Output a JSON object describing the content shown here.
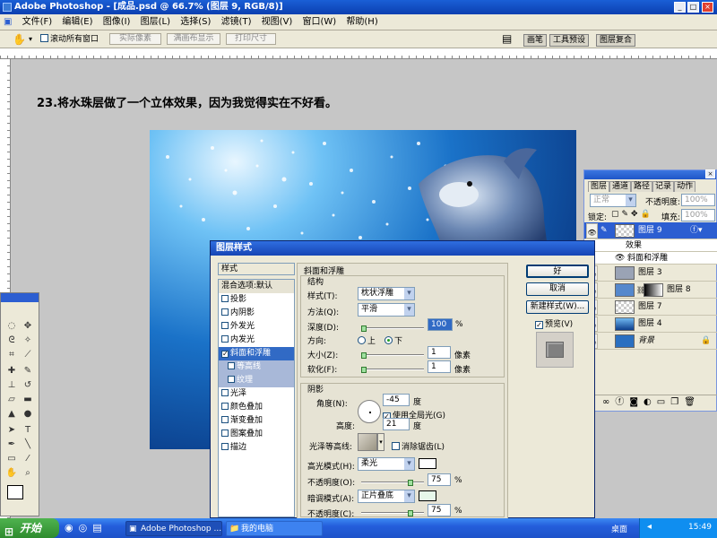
{
  "window": {
    "title": "Adobe Photoshop - [成品.psd @ 66.7% (图层 9, RGB/8)]"
  },
  "menu": [
    "文件(F)",
    "编辑(E)",
    "图像(I)",
    "图层(L)",
    "选择(S)",
    "滤镜(T)",
    "视图(V)",
    "窗口(W)",
    "帮助(H)"
  ],
  "options": {
    "scroll_all_label": "滚动所有窗口",
    "actual_pixels": "实际像素",
    "fit_screen": "满画布显示",
    "print_size": "打印尺寸"
  },
  "dock_tabs": [
    "画笔",
    "工具预设",
    "图层复合"
  ],
  "heading": "23.将水珠层做了一个立体效果，因为我觉得实在不好看。",
  "layers_panel": {
    "tabs": [
      "图层",
      "通道",
      "路径",
      "记录",
      "动作"
    ],
    "blend_mode": "正常",
    "opacity_label": "不透明度:",
    "opacity_value": "100%",
    "lock_label": "锁定:",
    "fill_label": "填充:",
    "fill_value": "100%",
    "layers": [
      {
        "name": "图层 9",
        "selected": true
      },
      {
        "name": "效果",
        "effect_header": true
      },
      {
        "name": "斜面和浮雕",
        "effect": true
      },
      {
        "name": "图层 3"
      },
      {
        "name": "图层 8"
      },
      {
        "name": "图层 7"
      },
      {
        "name": "图层 4"
      },
      {
        "name": "背景",
        "italic": true
      }
    ]
  },
  "dialog": {
    "title": "图层样式",
    "styles_header": "样式",
    "blend_options": "混合选项:默认",
    "styles": [
      {
        "label": "投影",
        "checked": false
      },
      {
        "label": "内阴影",
        "checked": false
      },
      {
        "label": "外发光",
        "checked": false
      },
      {
        "label": "内发光",
        "checked": false
      },
      {
        "label": "斜面和浮雕",
        "checked": true,
        "selected": true
      },
      {
        "label": "等高线",
        "sub": true
      },
      {
        "label": "纹理",
        "sub": true
      },
      {
        "label": "光泽",
        "checked": false
      },
      {
        "label": "颜色叠加",
        "checked": false
      },
      {
        "label": "渐变叠加",
        "checked": false
      },
      {
        "label": "图案叠加",
        "checked": false
      },
      {
        "label": "描边",
        "checked": false
      }
    ],
    "section_title": "斜面和浮雕",
    "structure_title": "结构",
    "style_label": "样式(T):",
    "style_value": "枕状浮雕",
    "technique_label": "方法(Q):",
    "technique_value": "平滑",
    "depth_label": "深度(D):",
    "depth_value": "100",
    "percent": "%",
    "direction_label": "方向:",
    "dir_up": "上",
    "dir_down": "下",
    "size_label": "大小(Z):",
    "size_value": "1",
    "soften_label": "软化(F):",
    "soften_value": "1",
    "px": "像素",
    "shading_title": "阴影",
    "angle_label": "角度(N):",
    "angle_value": "-45",
    "degree": "度",
    "global_light_label": "使用全局光(G)",
    "altitude_label": "高度:",
    "altitude_value": "21",
    "gloss_label": "光泽等高线:",
    "anti_alias_label": "消除锯齿(L)",
    "highlight_mode_label": "高光模式(H):",
    "highlight_mode_value": "柔光",
    "opacity_o_label": "不透明度(O):",
    "opacity_o_value": "75",
    "shadow_mode_label": "暗调模式(A):",
    "shadow_mode_value": "正片叠底",
    "opacity_c_label": "不透明度(C):",
    "opacity_c_value": "75",
    "buttons": {
      "ok": "好",
      "cancel": "取消",
      "new_style": "新建样式(W)...",
      "preview": "预览(V)"
    },
    "colors": {
      "highlight": "#ffffff",
      "shadow": "#e6f7ea"
    }
  },
  "taskbar": {
    "start": "开始",
    "tasks": [
      "Adobe Photoshop ...",
      "我的电脑"
    ],
    "desktop": "桌面",
    "time": "15:49"
  }
}
